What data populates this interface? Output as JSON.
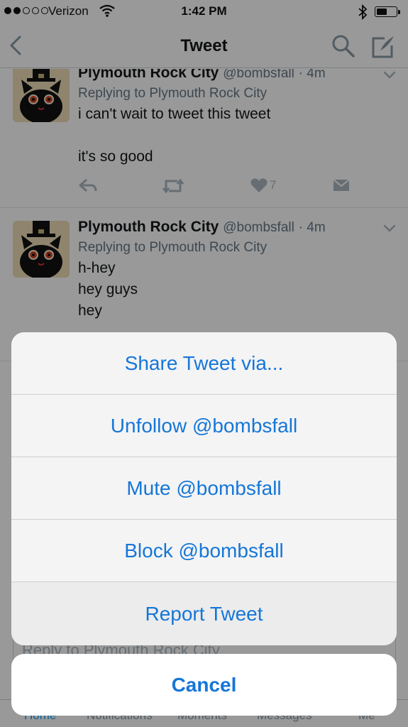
{
  "status_bar": {
    "carrier": "Verizon",
    "time": "1:42 PM",
    "signal_bars_filled": 2,
    "signal_bars_total": 5
  },
  "nav": {
    "title": "Tweet",
    "back_icon": "chevron-left-icon",
    "search_icon": "search-icon",
    "compose_icon": "compose-icon"
  },
  "tweets": [
    {
      "name": "Plymouth Rock City",
      "handle": "@bombsfall",
      "time": "· 4m",
      "reply_to": "Replying to Plymouth Rock City",
      "text": "i can't wait to tweet this tweet\n\nit's so good",
      "like_count": "7"
    },
    {
      "name": "Plymouth Rock City",
      "handle": "@bombsfall",
      "time": "· 4m",
      "reply_to": "Replying to Plymouth Rock City",
      "text": "h-hey\nhey guys\nhey"
    }
  ],
  "reply_placeholder": "Reply to Plymouth Rock City",
  "tabs": [
    "Home",
    "Notifications",
    "Moments",
    "Messages",
    "Me"
  ],
  "action_sheet": {
    "items": [
      "Share Tweet via...",
      "Unfollow @bombsfall",
      "Mute @bombsfall",
      "Block @bombsfall",
      "Report Tweet"
    ],
    "cancel": "Cancel"
  },
  "colors": {
    "accent": "#1576d8",
    "twitter_blue": "#1da1f2",
    "secondary_text": "#657786"
  }
}
